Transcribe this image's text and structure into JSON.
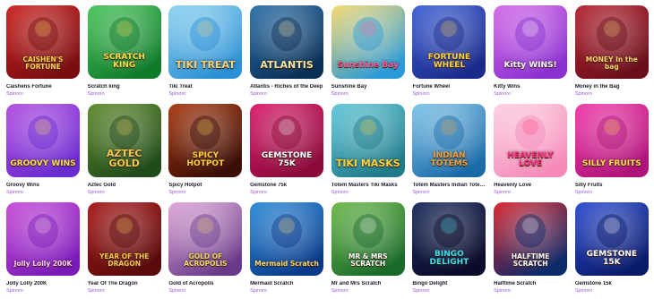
{
  "games": [
    {
      "name": "Caishens Fortune",
      "provider": "Spinoro",
      "art": "CAISHEN'S FORTUNE",
      "bg1": "#7a0d10",
      "bg2": "#c9201d",
      "fg": "#ffd34a"
    },
    {
      "name": "Scratch king",
      "provider": "Spinoro",
      "art": "SCRATCH KING",
      "bg1": "#0f7a2a",
      "bg2": "#48c45a",
      "fg": "#ffdd44"
    },
    {
      "name": "Tiki Treat",
      "provider": "Spinoro",
      "art": "TIKI TREAT",
      "bg1": "#2a8fd4",
      "bg2": "#8fd3f0",
      "fg": "#f2d27a"
    },
    {
      "name": "Atlantis - Riches of the Deep",
      "provider": "Spinoro",
      "art": "ATLANTIS",
      "bg1": "#0a2f55",
      "bg2": "#2a6fa8",
      "fg": "#f6e3a0"
    },
    {
      "name": "Sunshine Bay",
      "provider": "Spinoro",
      "art": "Sunshine Bay",
      "bg1": "#2a9ad8",
      "bg2": "#f5d86a",
      "fg": "#ff5aa0"
    },
    {
      "name": "Fortune Wheel",
      "provider": "Spinoro",
      "art": "FORTUNE WHEEL",
      "bg1": "#1a2a8a",
      "bg2": "#3d5fd6",
      "fg": "#ffd23a"
    },
    {
      "name": "Kitty Wins",
      "provider": "Spinoro",
      "art": "Kitty WINS!",
      "bg1": "#8a2fd0",
      "bg2": "#d36be8",
      "fg": "#ffffff"
    },
    {
      "name": "Money in the Bag",
      "provider": "Spinoro",
      "art": "MONEY In the bag",
      "bg1": "#6a0f1a",
      "bg2": "#b52330",
      "fg": "#f5d36a"
    },
    {
      "name": "Groovy Wins",
      "provider": "Spinoro",
      "art": "GROOVY WINS",
      "bg1": "#6a2bd0",
      "bg2": "#b14ce0",
      "fg": "#ffe04a"
    },
    {
      "name": "Aztec Gold",
      "provider": "Spinoro",
      "art": "AZTEC GOLD",
      "bg1": "#1f4a1a",
      "bg2": "#5e8a2a",
      "fg": "#f2c84a"
    },
    {
      "name": "Spicy Hotpot",
      "provider": "Spinoro",
      "art": "SPICY HOTPOT",
      "bg1": "#3a0e06",
      "bg2": "#a8360d",
      "fg": "#ffd23a"
    },
    {
      "name": "Gemstone 75k",
      "provider": "Spinoro",
      "art": "GEMSTONE 75K",
      "bg1": "#8a0a3a",
      "bg2": "#d81b6a",
      "fg": "#ffffff"
    },
    {
      "name": "Totem Masters Tiki Masks",
      "provider": "Spinoro",
      "art": "TIKI MASKS",
      "bg1": "#1f7a8a",
      "bg2": "#5fc7d8",
      "fg": "#ffd23a"
    },
    {
      "name": "Totem Masters Indian Totems",
      "provider": "Spinoro",
      "art": "INDIAN TOTEMS",
      "bg1": "#1a6aa8",
      "bg2": "#7fc4ea",
      "fg": "#f2a23a"
    },
    {
      "name": "Heavenly Love",
      "provider": "Spinoro",
      "art": "HEAVENLY LOVE",
      "bg1": "#f58ab8",
      "bg2": "#fcd0e2",
      "fg": "#ff2f7a"
    },
    {
      "name": "Silly Fruits",
      "provider": "Spinoro",
      "art": "SILLY FRUITS",
      "bg1": "#b0137a",
      "bg2": "#f03aa8",
      "fg": "#ffe04a"
    },
    {
      "name": "Jolly Lolly 200K",
      "provider": "Spinoro",
      "art": "Jolly Lolly 200K",
      "bg1": "#7a1ab8",
      "bg2": "#c84ad8",
      "fg": "#ffd0f0"
    },
    {
      "name": "Year Of The Dragon",
      "provider": "Spinoro",
      "art": "YEAR OF THE DRAGON",
      "bg1": "#5a0a0a",
      "bg2": "#a81818",
      "fg": "#f5c84a"
    },
    {
      "name": "Gold of Acropolis",
      "provider": "Spinoro",
      "art": "GOLD OF ACROPOLIS",
      "bg1": "#6a3a8a",
      "bg2": "#e0a8d8",
      "fg": "#f5d86a"
    },
    {
      "name": "Mermaid Scratch",
      "provider": "Spinoro",
      "art": "Mermaid Scratch",
      "bg1": "#0a3a8a",
      "bg2": "#2a8ad8",
      "fg": "#ffd86a"
    },
    {
      "name": "Mr and Mrs Scratch",
      "provider": "Spinoro",
      "art": "MR & MRS SCRATCH",
      "bg1": "#1a6a2a",
      "bg2": "#6ab84a",
      "fg": "#ffffff"
    },
    {
      "name": "Bingo Delight",
      "provider": "Spinoro",
      "art": "BINGO DELIGHT",
      "bg1": "#0a0a2a",
      "bg2": "#1a2a5a",
      "fg": "#3ae0f0"
    },
    {
      "name": "Halftime Scratch",
      "provider": "Spinoro",
      "art": "HALFTIME SCRATCH",
      "bg1": "#0a2a6a",
      "bg2": "#d8202a",
      "fg": "#ffffff"
    },
    {
      "name": "Gemstone 15k",
      "provider": "Spinoro",
      "art": "GEMSTONE 15K",
      "bg1": "#0a1a6a",
      "bg2": "#2a4ad0",
      "fg": "#ffffff"
    }
  ]
}
